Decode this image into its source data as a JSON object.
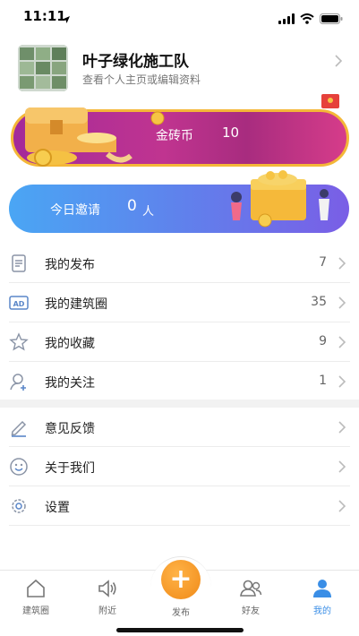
{
  "status": {
    "time": "11:11"
  },
  "profile": {
    "name": "叶子绿化施工队",
    "subtitle": "查看个人主页或编辑资料"
  },
  "coin_card": {
    "label": "金砖币",
    "value": "10"
  },
  "invite_card": {
    "label": "今日邀请",
    "value": "0",
    "unit": "人"
  },
  "menu_group_1": [
    {
      "label": "我的发布",
      "count": "7",
      "icon": "document-icon"
    },
    {
      "label": "我的建筑圈",
      "count": "35",
      "icon": "ad-icon"
    },
    {
      "label": "我的收藏",
      "count": "9",
      "icon": "star-icon"
    },
    {
      "label": "我的关注",
      "count": "1",
      "icon": "user-follow-icon"
    }
  ],
  "menu_group_2": [
    {
      "label": "意见反馈",
      "icon": "pencil-icon"
    },
    {
      "label": "关于我们",
      "icon": "smile-icon"
    },
    {
      "label": "设置",
      "icon": "gear-icon"
    }
  ],
  "tabbar": {
    "items": [
      {
        "label": "建筑圈",
        "icon": "home-icon"
      },
      {
        "label": "附近",
        "icon": "speaker-icon"
      },
      {
        "label": "发布",
        "icon": "plus-icon"
      },
      {
        "label": "好友",
        "icon": "friends-icon"
      },
      {
        "label": "我的",
        "icon": "person-icon"
      }
    ],
    "active_index": 4
  },
  "colors": {
    "accent": "#3a8ee6",
    "coin_gradient_start": "#a32a9a",
    "coin_border": "#f4b738",
    "invite_gradient_start": "#4aa6f4",
    "invite_gradient_end": "#7a5ee6",
    "publish_button": "#f08a18"
  }
}
